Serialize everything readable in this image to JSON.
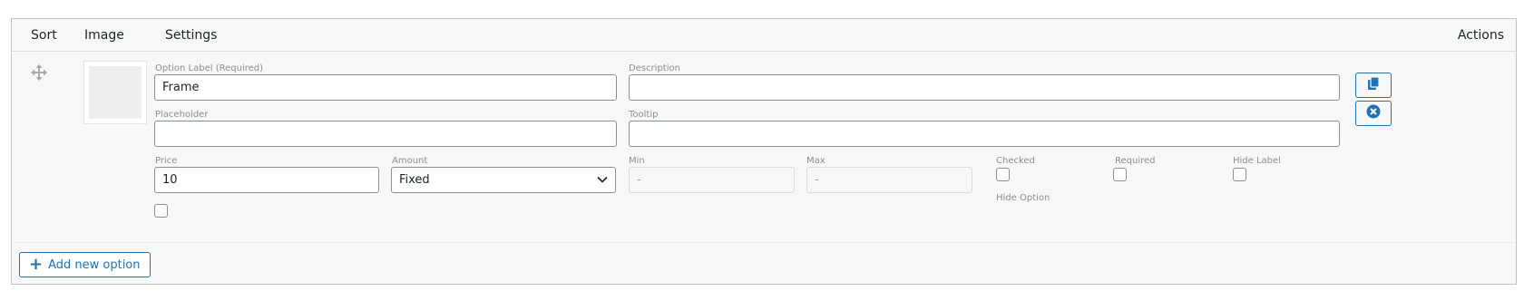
{
  "table": {
    "headers": {
      "sort": "Sort",
      "image": "Image",
      "settings": "Settings",
      "actions": "Actions"
    }
  },
  "option": {
    "label_field": {
      "label": "Option Label (Required)",
      "value": "Frame"
    },
    "description_field": {
      "label": "Description",
      "value": ""
    },
    "placeholder_field": {
      "label": "Placeholder",
      "value": ""
    },
    "tooltip_field": {
      "label": "Tooltip",
      "value": ""
    },
    "price_field": {
      "label": "Price",
      "value": "10"
    },
    "amount_field": {
      "label": "Amount",
      "selected": "Fixed"
    },
    "min_field": {
      "label": "Min",
      "placeholder": "-"
    },
    "max_field": {
      "label": "Max",
      "placeholder": "-"
    },
    "checked": {
      "label": "Checked",
      "checked": false
    },
    "required": {
      "label": "Required",
      "checked": false
    },
    "hide_label": {
      "label": "Hide Label",
      "checked": false
    },
    "hide_option": {
      "label": "Hide Option"
    },
    "extra_checkbox": {
      "checked": false
    }
  },
  "actions": {
    "duplicate_icon": "duplicate-icon",
    "remove_icon": "remove-circle-icon"
  },
  "footer": {
    "add_button_label": "Add new option"
  },
  "colors": {
    "accent": "#2271b1",
    "border": "#8c8f94",
    "panel_bg": "#f6f7f7"
  }
}
